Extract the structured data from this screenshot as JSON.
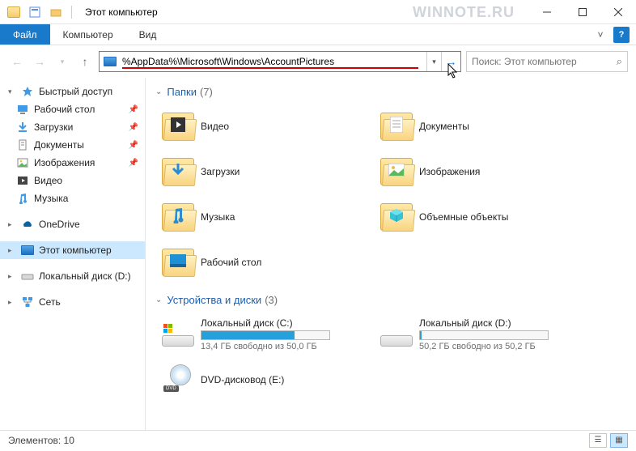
{
  "window": {
    "title": "Этот компьютер"
  },
  "watermark": "WINNOTE.RU",
  "ribbon": {
    "file": "Файл",
    "computer": "Компьютер",
    "view": "Вид"
  },
  "address": {
    "path": "%AppData%\\Microsoft\\Windows\\AccountPictures"
  },
  "search": {
    "placeholder": "Поиск: Этот компьютер"
  },
  "sidebar": {
    "quick": "Быстрый доступ",
    "desktop": "Рабочий стол",
    "downloads": "Загрузки",
    "documents": "Документы",
    "pictures": "Изображения",
    "video": "Видео",
    "music": "Музыка",
    "onedrive": "OneDrive",
    "thispc": "Этот компьютер",
    "localD": "Локальный диск (D:)",
    "network": "Сеть"
  },
  "groups": {
    "folders": {
      "label": "Папки",
      "count": "(7)"
    },
    "drives": {
      "label": "Устройства и диски",
      "count": "(3)"
    }
  },
  "folders": {
    "video": "Видео",
    "documents": "Документы",
    "downloads": "Загрузки",
    "pictures": "Изображения",
    "music": "Музыка",
    "objects3d": "Объемные объекты",
    "desktop": "Рабочий стол"
  },
  "drives": {
    "c": {
      "label": "Локальный диск (C:)",
      "sub": "13,4 ГБ свободно из 50,0 ГБ",
      "fill": 73
    },
    "d": {
      "label": "Локальный диск (D:)",
      "sub": "50,2 ГБ свободно из 50,2 ГБ",
      "fill": 1
    },
    "dvd": {
      "label": "DVD-дисковод (E:)"
    }
  },
  "status": {
    "text": "Элементов: 10"
  }
}
